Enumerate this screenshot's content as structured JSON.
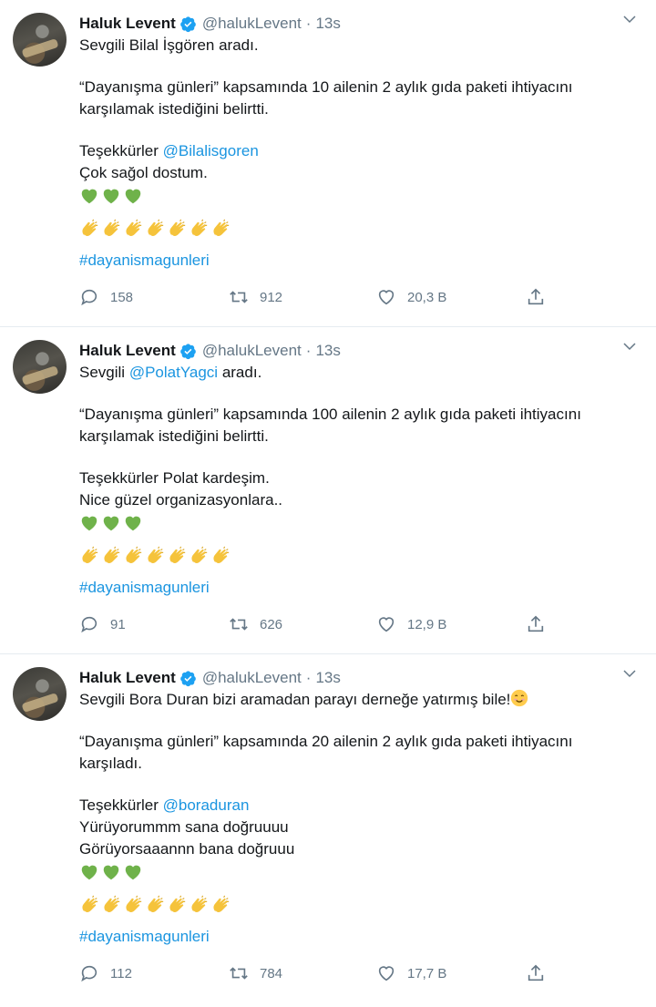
{
  "tweets": [
    {
      "author": {
        "name": "Haluk Levent",
        "handle": "@halukLevent",
        "separator": "·",
        "time": "13s"
      },
      "lines": [
        [
          "Sevgili Bilal İşgören aradı."
        ],
        [],
        [
          "“Dayanışma günleri” kapsamında 10 ailenin 2 aylık gıda paketi ihtiyacını"
        ],
        [
          "karşılamak istediğini belirtti."
        ],
        [],
        [
          "Teşekkürler ",
          "@Bilalisgoren"
        ],
        [
          "Çok sağol dostum."
        ]
      ],
      "hashtag": "#dayanismagunleri",
      "stats": {
        "replies": "158",
        "retweets": "912",
        "likes": "20,3 B"
      }
    },
    {
      "author": {
        "name": "Haluk Levent",
        "handle": "@halukLevent",
        "separator": "·",
        "time": "13s"
      },
      "lines": [
        [
          "Sevgili ",
          "@PolatYagci",
          " aradı."
        ],
        [],
        [
          "“Dayanışma günleri” kapsamında 100 ailenin 2 aylık gıda paketi ihtiyacını"
        ],
        [
          "karşılamak istediğini belirtti."
        ],
        [],
        [
          "Teşekkürler Polat kardeşim."
        ],
        [
          "Nice güzel organizasyonlara.."
        ]
      ],
      "hashtag": "#dayanismagunleri",
      "stats": {
        "replies": "91",
        "retweets": "626",
        "likes": "12,9 B"
      }
    },
    {
      "author": {
        "name": "Haluk Levent",
        "handle": "@halukLevent",
        "separator": "·",
        "time": "13s"
      },
      "lines": [
        [
          "Sevgili Bora Duran bizi aramadan parayı derneğe yatırmış bile!"
        ],
        [],
        [
          "“Dayanışma günleri” kapsamında 20 ailenin 2 aylık gıda paketi ihtiyacını"
        ],
        [
          "karşıladı."
        ],
        [],
        [
          "Teşekkürler ",
          "@boraduran"
        ],
        [
          "Yürüyorummm sana doğruuuu"
        ],
        [
          "Görüyorsaaannn bana doğruuu"
        ]
      ],
      "hashtag": "#dayanismagunleri",
      "stats": {
        "replies": "112",
        "retweets": "784",
        "likes": "17,7 B"
      }
    }
  ],
  "emoji": {
    "heart_count": 3,
    "clap_count": 7,
    "heart": "green-heart-icon",
    "clap": "clapping-hands-icon",
    "smile": "smiling-face-icon"
  },
  "colors": {
    "link": "#1b95e0",
    "muted": "#657786",
    "verified": "#1da1f2",
    "heart_green": "#6fb24a",
    "clap_yellow": "#f5c33b"
  }
}
